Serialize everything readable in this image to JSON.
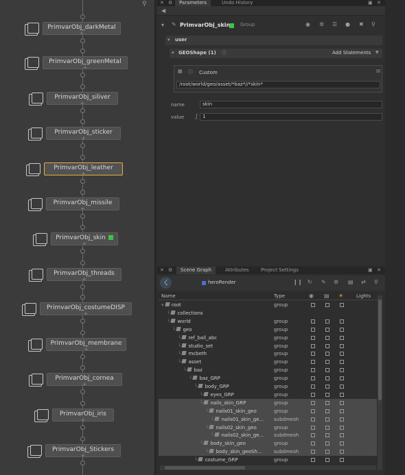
{
  "node_graph": {
    "nodes": [
      {
        "label": "PrimvarObj_darkMetal"
      },
      {
        "label": "PrimvarObj_greenMetal"
      },
      {
        "label": "PrimvarObj_siliver"
      },
      {
        "label": "PrimvarObj_sticker"
      },
      {
        "label": "PrimvarObj_leather",
        "selected": true
      },
      {
        "label": "PrimvarObj_missile"
      },
      {
        "label": "PrimvarObj_skin",
        "flag": "green"
      },
      {
        "label": "PrimvarObj_threads"
      },
      {
        "label": "PrimvarObj_costumeDISP"
      },
      {
        "label": "PrimvarObj_membrane"
      },
      {
        "label": "PrimvarObj_cornea"
      },
      {
        "label": "PrimvarObj_iris"
      },
      {
        "label": "PrimvarObj_Stickers"
      }
    ],
    "plus_glyph": "+"
  },
  "parameters": {
    "tabs": [
      "Parameters",
      "Undo History"
    ],
    "node_name": "PrimvarObj_skin",
    "node_type": "Group",
    "section": "user",
    "geoshape_label": "GEOShape (1)",
    "add_statements": "Add Statements",
    "custom_label": "Custom",
    "path_value": "/root/world/geo/asset/*baz*//*skin*",
    "name_label": "name",
    "name_value": "skin",
    "value_label": "value",
    "value_value": "1"
  },
  "scene_graph": {
    "tabs": [
      "Scene Graph",
      "Attributes",
      "Project Settings"
    ],
    "render_label": "heroRender",
    "columns": {
      "name": "Name",
      "type": "Type",
      "lights": "Lights"
    },
    "rows": [
      {
        "name": "root",
        "type": "group",
        "indent": 0,
        "hl": false
      },
      {
        "name": "collections",
        "type": "",
        "indent": 1,
        "hl": false
      },
      {
        "name": "world",
        "type": "group",
        "indent": 1,
        "hl": false
      },
      {
        "name": "geo",
        "type": "group",
        "indent": 2,
        "hl": false
      },
      {
        "name": "ref_ball_abc",
        "type": "group",
        "indent": 3,
        "hl": false
      },
      {
        "name": "studio_set",
        "type": "group",
        "indent": 3,
        "hl": false
      },
      {
        "name": "mcbeth",
        "type": "group",
        "indent": 3,
        "hl": false
      },
      {
        "name": "asset",
        "type": "group",
        "indent": 3,
        "hl": false
      },
      {
        "name": "baz",
        "type": "group",
        "indent": 4,
        "hl": false
      },
      {
        "name": "baz_GRP",
        "type": "group",
        "indent": 5,
        "hl": false
      },
      {
        "name": "body_GRP",
        "type": "group",
        "indent": 6,
        "hl": false
      },
      {
        "name": "eyes_GRP",
        "type": "group",
        "indent": 7,
        "hl": false
      },
      {
        "name": "nails_skin_GRP",
        "type": "group",
        "indent": 7,
        "hl": true
      },
      {
        "name": "nails01_skin_geo",
        "type": "group",
        "indent": 8,
        "hl": true
      },
      {
        "name": "nails01_skin_ge...",
        "type": "subdmesh",
        "indent": 9,
        "hl": true
      },
      {
        "name": "nails02_skin_geo",
        "type": "group",
        "indent": 8,
        "hl": true
      },
      {
        "name": "nails02_skin_ge...",
        "type": "subdmesh",
        "indent": 9,
        "hl": true
      },
      {
        "name": "body_skin_geo",
        "type": "group",
        "indent": 7,
        "hl": true
      },
      {
        "name": "body_skin_geoSh...",
        "type": "subdmesh",
        "indent": 8,
        "hl": true
      },
      {
        "name": "costume_GRP",
        "type": "group",
        "indent": 6,
        "hl": false
      }
    ]
  },
  "colors": {
    "accent_selected": "#e0b33a",
    "status_green": "#3ec24b",
    "tag_blue": "#4b6fd6"
  },
  "icons": [
    "search-icon",
    "gear-icon",
    "close-icon",
    "folder-icon",
    "pause-icon",
    "lock-icon"
  ]
}
